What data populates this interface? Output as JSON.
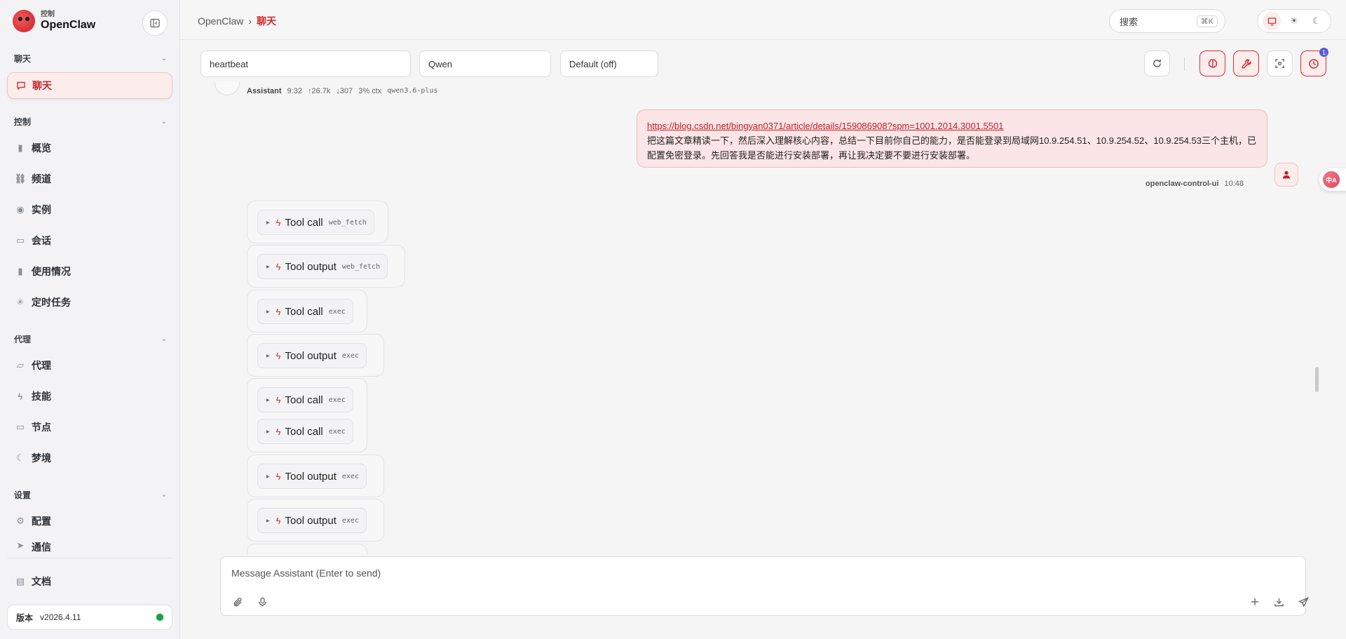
{
  "sidebar": {
    "brand_sub": "控制",
    "brand_main": "OpenClaw",
    "sections": {
      "chat": "聊天",
      "control": "控制",
      "agent": "代理",
      "settings": "设置"
    },
    "items": {
      "chat": "聊天",
      "overview": "概览",
      "channels": "频道",
      "instances": "实例",
      "sessions": "会话",
      "usage": "使用情况",
      "cron": "定时任务",
      "agents": "代理",
      "skills": "技能",
      "nodes": "节点",
      "dreams": "梦境",
      "config": "配置",
      "comms": "通信",
      "docs": "文档"
    },
    "version_label": "版本",
    "version_value": "v2026.4.11"
  },
  "topbar": {
    "breadcrumb_root": "OpenClaw",
    "breadcrumb_sep": "›",
    "breadcrumb_current": "聊天",
    "search_label": "搜索",
    "search_kbd": "⌘K"
  },
  "controls": {
    "session": "heartbeat",
    "model": "Qwen",
    "thinking": "Default (off)",
    "cron_badge": "1"
  },
  "chat": {
    "prev_meta": {
      "role": "Assistant",
      "time": "9:32",
      "tokens_in": "↑26.7k",
      "tokens_out": "↓307",
      "ctx": "3% ctx",
      "model": "qwen3.6-plus"
    },
    "user_message": {
      "link": "https://blog.csdn.net/bingyan0371/article/details/159086908?spm=1001.2014.3001.5501",
      "text": "把这篇文章精读一下，然后深入理解核心内容，总结一下目前你自己的能力，是否能登录到局域网10.9.254.51、10.9.254.52、10.9.254.53三个主机，已配置免密登录。先回答我是否能进行安装部署，再让我决定要不要进行安装部署。",
      "sender": "openclaw-control-ui",
      "time": "10:48"
    },
    "tools": [
      {
        "label": "Tool call",
        "tag": "web_fetch"
      },
      {
        "label": "Tool output",
        "tag": "web_fetch"
      },
      {
        "label": "Tool call",
        "tag": "exec"
      },
      {
        "label": "Tool output",
        "tag": "exec"
      },
      {
        "label": "Tool call",
        "tag": "exec"
      },
      {
        "label": "Tool call",
        "tag": "exec"
      },
      {
        "label": "Tool output",
        "tag": "exec"
      },
      {
        "label": "Tool output",
        "tag": "exec"
      }
    ]
  },
  "composer": {
    "placeholder": "Message Assistant (Enter to send)"
  },
  "translate_badge": "中A"
}
